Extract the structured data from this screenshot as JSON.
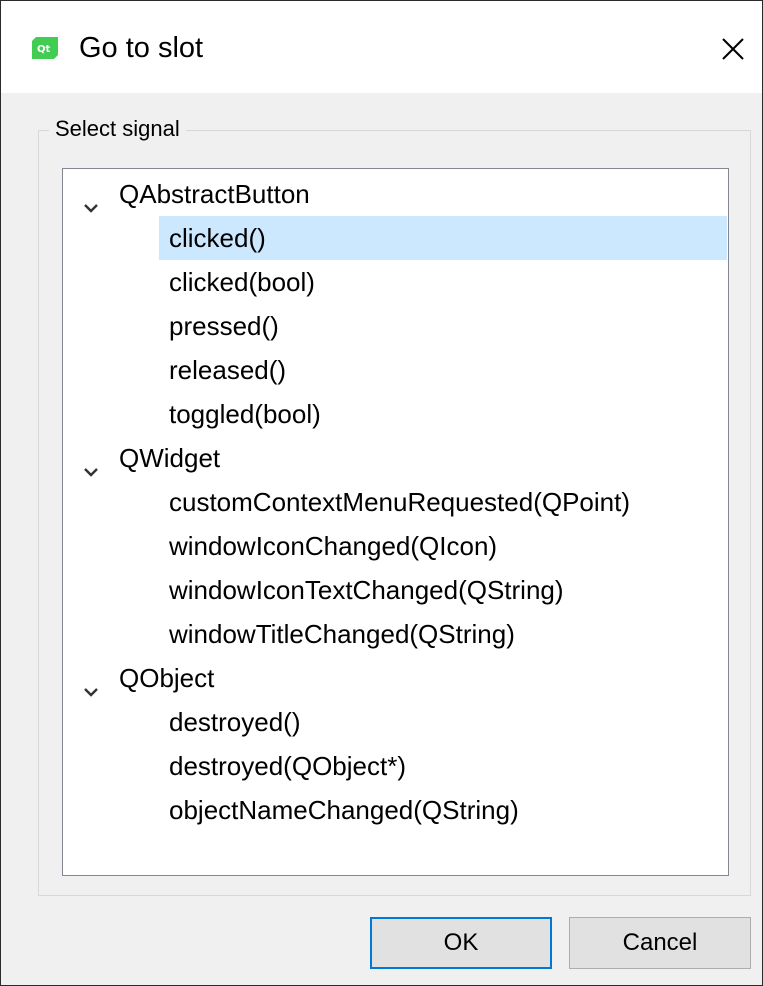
{
  "window": {
    "title": "Go to slot",
    "app_icon": "qt-creator-icon",
    "close_icon": "close-icon"
  },
  "groupbox": {
    "title": "Select signal"
  },
  "tree": {
    "groups": [
      {
        "name": "QAbstractButton",
        "expanded": true,
        "signals": [
          "clicked()",
          "clicked(bool)",
          "pressed()",
          "released()",
          "toggled(bool)"
        ]
      },
      {
        "name": "QWidget",
        "expanded": true,
        "signals": [
          "customContextMenuRequested(QPoint)",
          "windowIconChanged(QIcon)",
          "windowIconTextChanged(QString)",
          "windowTitleChanged(QString)"
        ]
      },
      {
        "name": "QObject",
        "expanded": true,
        "signals": [
          "destroyed()",
          "destroyed(QObject*)",
          "objectNameChanged(QString)"
        ]
      }
    ],
    "selected": "clicked()"
  },
  "buttons": {
    "ok_label": "OK",
    "cancel_label": "Cancel"
  },
  "colors": {
    "selection": "#cce8ff",
    "default_button_border": "#0078d7",
    "qt_green": "#41cd52"
  }
}
